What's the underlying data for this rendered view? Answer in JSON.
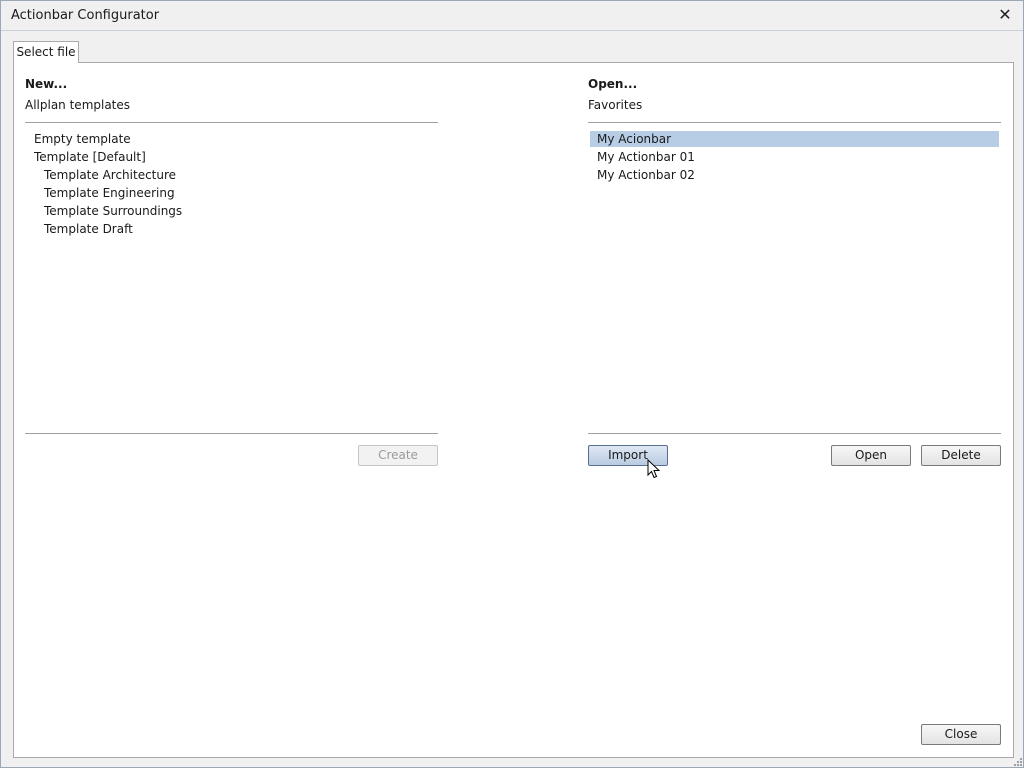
{
  "window": {
    "title": "Actionbar Configurator"
  },
  "tabs": [
    {
      "label": "Select file"
    }
  ],
  "new_section": {
    "heading": "New...",
    "subheading": "Allplan templates",
    "items": [
      {
        "label": "Empty template"
      },
      {
        "label": "Template [Default]"
      },
      {
        "label": "Template Architecture"
      },
      {
        "label": "Template Engineering"
      },
      {
        "label": "Template Surroundings"
      },
      {
        "label": "Template Draft"
      }
    ],
    "create_label": "Create"
  },
  "open_section": {
    "heading": "Open...",
    "subheading": "Favorites",
    "items": [
      {
        "label": "My Acionbar",
        "selected": true
      },
      {
        "label": "My Actionbar 01"
      },
      {
        "label": "My Actionbar 02"
      }
    ],
    "import_label": "Import",
    "open_label": "Open",
    "delete_label": "Delete"
  },
  "footer": {
    "close_label": "Close"
  },
  "colors": {
    "selection": "#b7cde6",
    "border": "#a9a9a9",
    "hover_button": "#b9cbe2"
  }
}
